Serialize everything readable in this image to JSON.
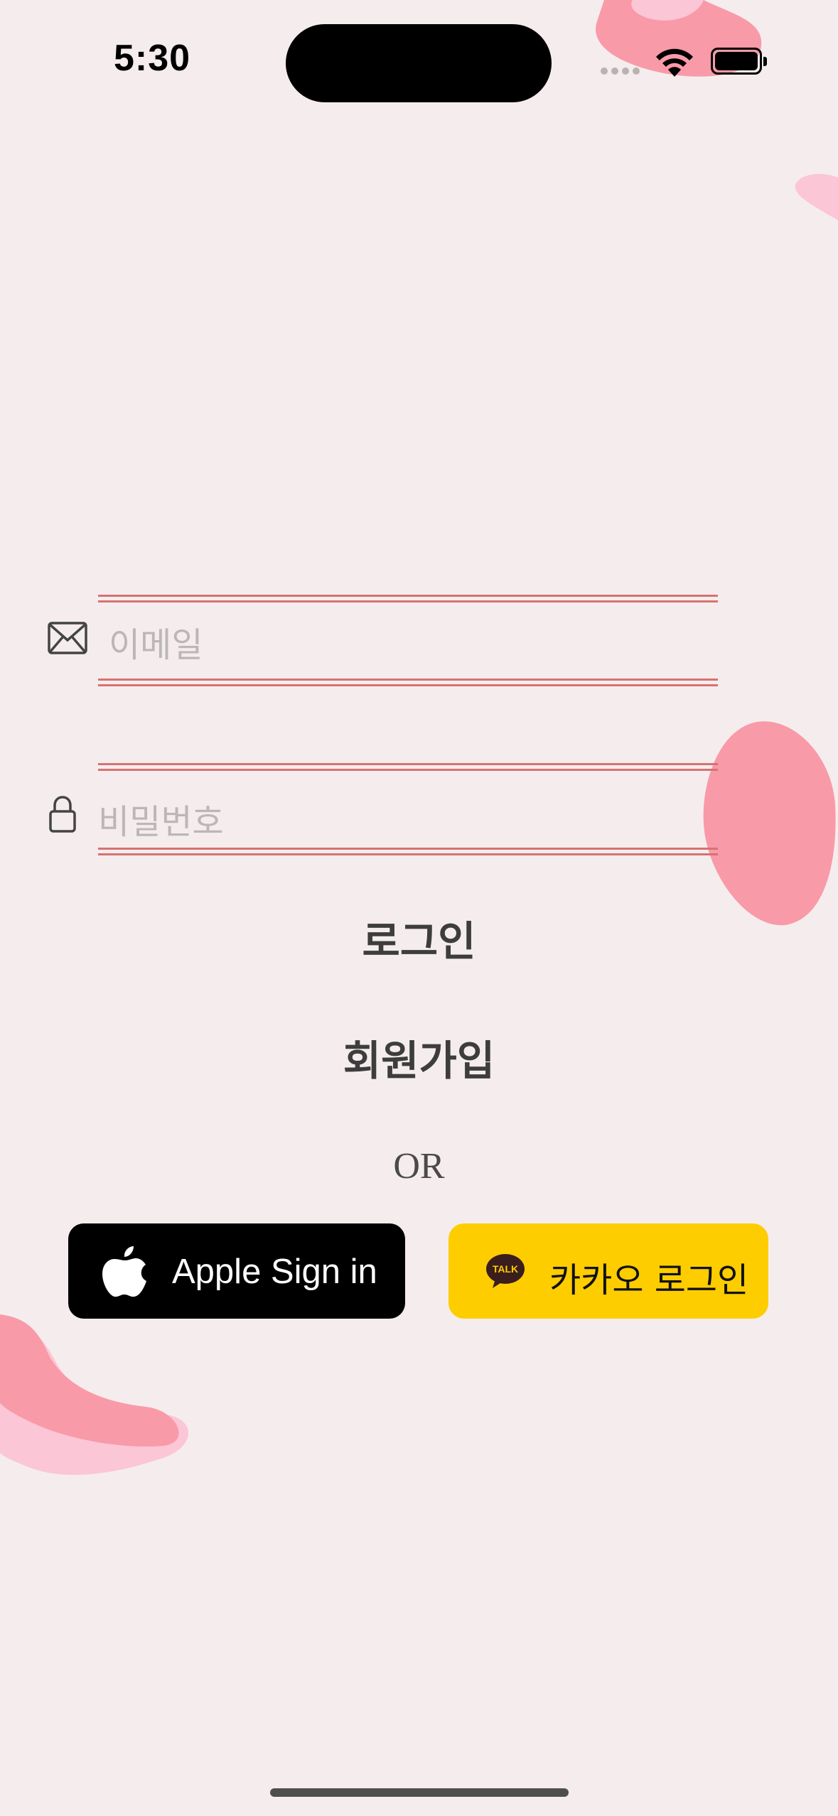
{
  "status_bar": {
    "time": "5:30"
  },
  "login_form": {
    "email_placeholder": "이메일",
    "password_placeholder": "비밀번호",
    "email_icon": "envelope-icon",
    "password_icon": "lock-icon"
  },
  "actions": {
    "login_label": "로그인",
    "signup_label": "회원가입",
    "or_label": "OR"
  },
  "social": {
    "apple_label": "Apple Sign in",
    "apple_icon": "apple-logo-icon",
    "kakao_label": "카카오 로그인",
    "kakao_icon": "kakao-talk-icon",
    "kakao_icon_text": "TALK"
  },
  "colors": {
    "background": "#f5eded",
    "field_line": "#d67272",
    "kakao_yellow": "#fecd00",
    "apple_black": "#000000",
    "blob_pink": "#f99aa8",
    "blob_light_pink": "#fbc6d6"
  }
}
